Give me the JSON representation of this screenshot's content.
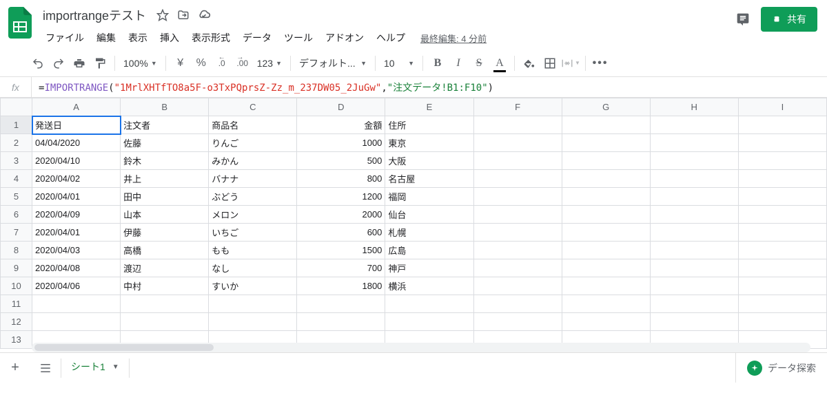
{
  "doc": {
    "title": "importrangeテスト"
  },
  "menus": [
    "ファイル",
    "編集",
    "表示",
    "挿入",
    "表示形式",
    "データ",
    "ツール",
    "アドオン",
    "ヘルプ"
  ],
  "last_edit": "最終編集: 4 分前",
  "share_label": "共有",
  "toolbar": {
    "zoom": "100%",
    "currency": "¥",
    "percent": "%",
    "dec_dec": ".0",
    "dec_inc": ".00",
    "numfmt": "123",
    "font_family": "デフォルト...",
    "font_size": "10",
    "bold": "B",
    "italic": "I",
    "strike": "S",
    "tcolor": "A"
  },
  "formula": {
    "prefix": "=",
    "parts": [
      {
        "cls": "tok-id",
        "text": "IMPORTRANGE"
      },
      {
        "cls": "",
        "text": "("
      },
      {
        "cls": "tok-str-a",
        "text": "\"1MrlXHTfTO8a5F-o3TxPQprsZ-Zz_m_237DW05_2JuGw\""
      },
      {
        "cls": "",
        "text": ","
      },
      {
        "cls": "tok-str-b",
        "text": "\"注文データ!B1:F10\""
      },
      {
        "cls": "",
        "text": ")"
      }
    ]
  },
  "cols": [
    "A",
    "B",
    "C",
    "D",
    "E",
    "F",
    "G",
    "H",
    "I"
  ],
  "row_count": 13,
  "selected": {
    "row": 1,
    "col": 0
  },
  "rows": [
    [
      "発送日",
      "注文者",
      "商品名",
      "金額",
      "住所",
      "",
      "",
      "",
      ""
    ],
    [
      "04/04/2020",
      "佐藤",
      "りんご",
      "1000",
      "東京",
      "",
      "",
      "",
      ""
    ],
    [
      "2020/04/10",
      "鈴木",
      "みかん",
      "500",
      "大阪",
      "",
      "",
      "",
      ""
    ],
    [
      "2020/04/02",
      "井上",
      "バナナ",
      "800",
      "名古屋",
      "",
      "",
      "",
      ""
    ],
    [
      "2020/04/01",
      "田中",
      "ぶどう",
      "1200",
      "福岡",
      "",
      "",
      "",
      ""
    ],
    [
      "2020/04/09",
      "山本",
      "メロン",
      "2000",
      "仙台",
      "",
      "",
      "",
      ""
    ],
    [
      "2020/04/01",
      "伊藤",
      "いちご",
      "600",
      "札幌",
      "",
      "",
      "",
      ""
    ],
    [
      "2020/04/03",
      "高橋",
      "もも",
      "1500",
      "広島",
      "",
      "",
      "",
      ""
    ],
    [
      "2020/04/08",
      "渡辺",
      "なし",
      "700",
      "神戸",
      "",
      "",
      "",
      ""
    ],
    [
      "2020/04/06",
      "中村",
      "すいか",
      "1800",
      "横浜",
      "",
      "",
      "",
      ""
    ]
  ],
  "numeric_cols": [
    3
  ],
  "sheet_tab": "シート1",
  "explore_label": "データ探索"
}
